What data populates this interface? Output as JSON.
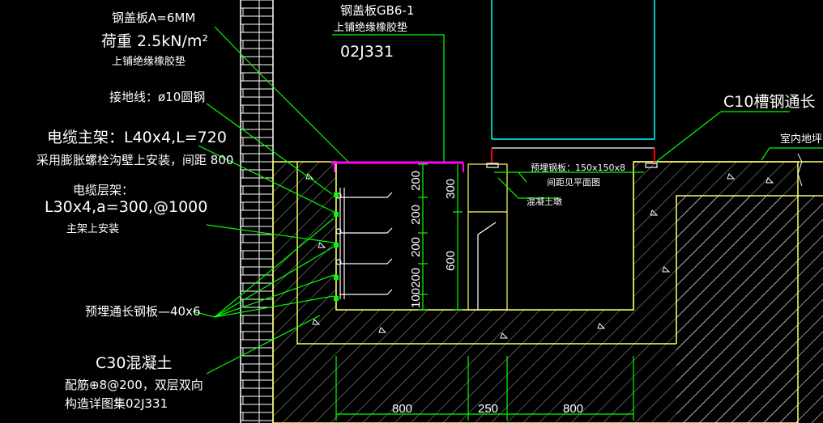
{
  "labels": {
    "cover_plate_a": "钢盖板A=6MM",
    "load": "荷重 2.5kN/m²",
    "rubber_pad_1": "上铺绝缘橡胶垫",
    "grounding": "接地线：ø10圆钢",
    "cable_main_frame": "电缆主架：L40x4,L=720",
    "expansion_bolt": "采用膨胀螺栓沟壁上安装，间距 800",
    "cable_layer_frame": "电缆层架：",
    "layer_spec": "L30x4,a=300,@1000",
    "on_main_frame": "主架上安装",
    "embedded_plate": "预埋通长钢板—40x6",
    "concrete": "C30混凝土",
    "rebar": "配筋⊕8@200，双层双向",
    "detail_ref": "构造详图集02J331",
    "cover_gb": "钢盖板GB6-1",
    "rubber_pad_2": "上铺绝缘橡胶垫",
    "ref_02j331": "02J331",
    "channel_steel": "C10槽钢通长",
    "indoor_floor": "室内地坪",
    "embedded_steel_plate": "预埋钢板：150x150x8",
    "spacing_see_plan": "间距见平面图",
    "concrete_pier": "混凝土墩"
  },
  "dimensions": {
    "tier_spacing": [
      "200",
      "200",
      "200",
      "200",
      "100"
    ],
    "depth_top": "300",
    "depth_bottom": "600",
    "widths": [
      "800",
      "250",
      "800"
    ]
  },
  "colors": {
    "background": "#000000",
    "wall_outline": "#ffff66",
    "leader": "#00ff00",
    "cover": "#ff00ff",
    "steel": "#ffffff",
    "cabinet": "#00ffff",
    "red": "#ff0000"
  }
}
